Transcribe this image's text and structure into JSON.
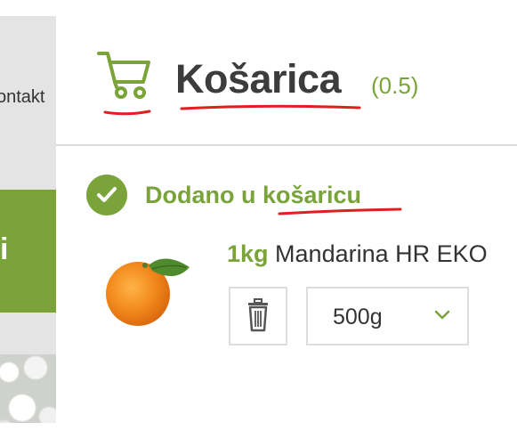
{
  "background_page": {
    "nav_item": "ontakt",
    "banner_text": "i"
  },
  "cart": {
    "title": "Košarica",
    "count": "(0.5)",
    "icon": "shopping-cart-icon"
  },
  "notice": {
    "icon": "check-circle-icon",
    "text_prefix": "Dodano u ",
    "text_highlight": "košaricu"
  },
  "item": {
    "quantity_label": "1kg",
    "name": "Mandarina HR EKO",
    "image": "tangerine-image",
    "delete_icon": "trash-icon",
    "selected_weight": "500g",
    "select_icon": "chevron-down-icon"
  },
  "colors": {
    "brand_green": "#7aa33a",
    "text_dark": "#3c3c3c",
    "annotation_red": "#e02020",
    "border_gray": "#dedede"
  }
}
